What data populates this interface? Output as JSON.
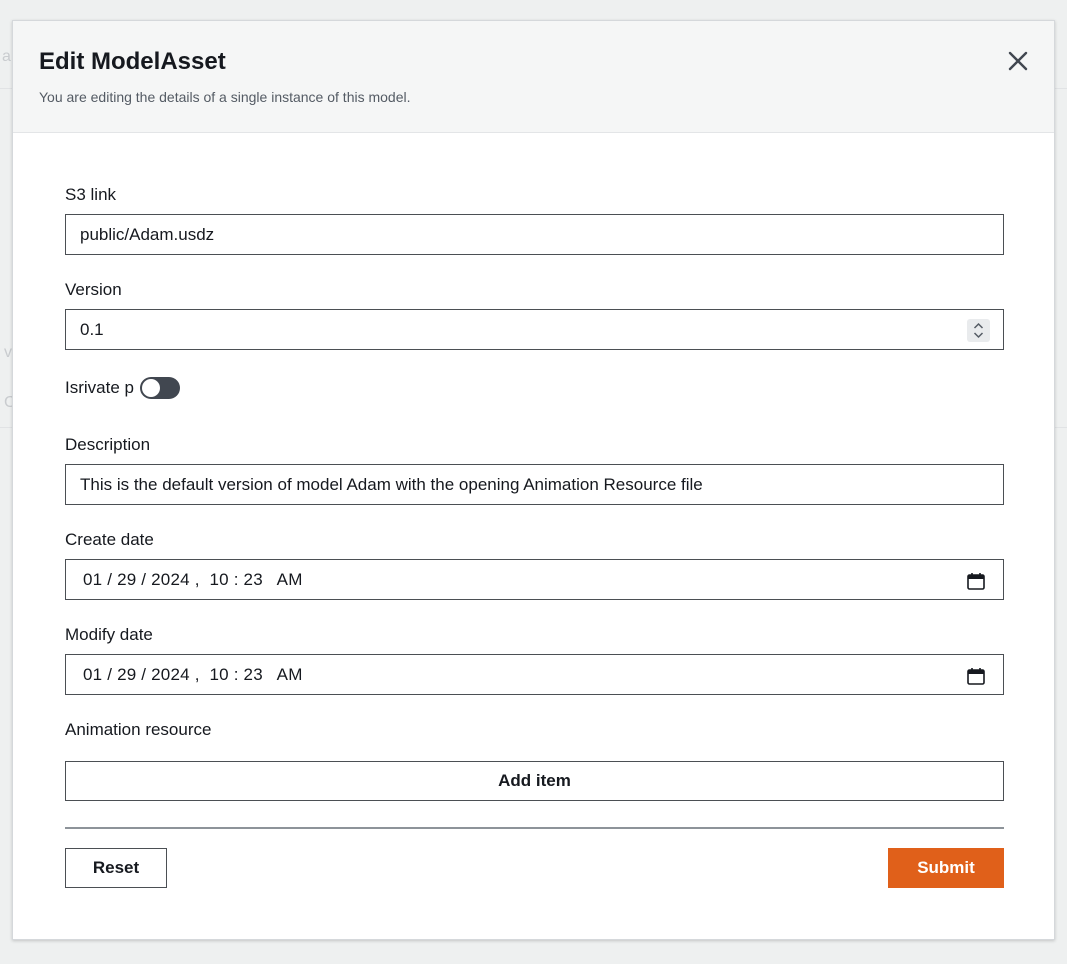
{
  "background": {
    "fragments": [
      "a",
      "v",
      "C"
    ]
  },
  "modal": {
    "title": "Edit ModelAsset",
    "subtitle": "You are editing the details of a single instance of this model."
  },
  "fields": {
    "s3_link": {
      "label": "S3 link",
      "value": "public/Adam.usdz"
    },
    "version": {
      "label": "Version",
      "value": "0.1"
    },
    "is_private": {
      "label": "Isrivate p",
      "checked": false
    },
    "description": {
      "label": "Description",
      "value": "This is the default version of model Adam with the opening Animation Resource file"
    },
    "create_date": {
      "label": "Create date",
      "value": "01 / 29 / 2024 ,  10 : 23   AM"
    },
    "modify_date": {
      "label": "Modify date",
      "value": "01 / 29 / 2024 ,  10 : 23   AM"
    },
    "animation_resource": {
      "label": "Animation resource",
      "add_label": "Add item"
    }
  },
  "actions": {
    "reset_label": "Reset",
    "submit_label": "Submit"
  },
  "colors": {
    "accent": "#e0601a",
    "toggle_off": "#414750",
    "border": "#4b4f54"
  },
  "icons": {
    "close": "close-icon",
    "spinner": "spinner-icon",
    "calendar": "calendar-icon"
  }
}
